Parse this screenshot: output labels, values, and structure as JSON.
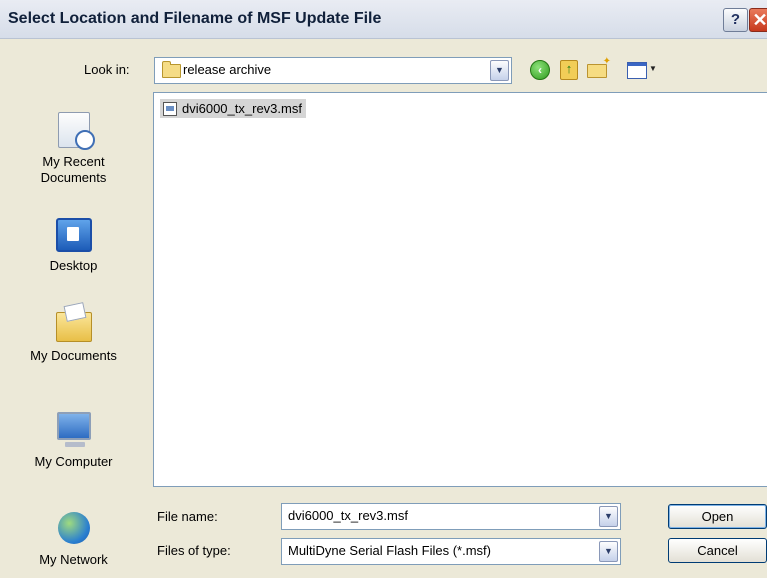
{
  "window": {
    "title": "Select Location and Filename of MSF Update File",
    "help_label": "?",
    "close_label": "✕"
  },
  "toolbar": {
    "look_in_label": "Look in:",
    "look_in_value": "release archive",
    "icons": [
      "back-icon",
      "up-folder-icon",
      "new-folder-icon",
      "views-menu-icon"
    ]
  },
  "places": [
    {
      "label": "My Recent Documents",
      "icon": "recent-documents-icon"
    },
    {
      "label": "Desktop",
      "icon": "desktop-icon"
    },
    {
      "label": "My Documents",
      "icon": "my-documents-icon"
    },
    {
      "label": "My Computer",
      "icon": "my-computer-icon"
    },
    {
      "label": "My Network",
      "icon": "my-network-icon"
    }
  ],
  "files": [
    {
      "name": "dvi6000_tx_rev3.msf",
      "icon": "msf-file-icon",
      "selected": true
    }
  ],
  "form": {
    "file_name_label": "File name:",
    "file_name_value": "dvi6000_tx_rev3.msf",
    "file_type_label": "Files of type:",
    "file_type_value": "MultiDyne Serial Flash Files (*.msf)"
  },
  "buttons": {
    "open": "Open",
    "cancel": "Cancel"
  },
  "colors": {
    "dialog_bg": "#ece9d8",
    "selection": "#d5d5d5",
    "field_border": "#7f9db9"
  }
}
